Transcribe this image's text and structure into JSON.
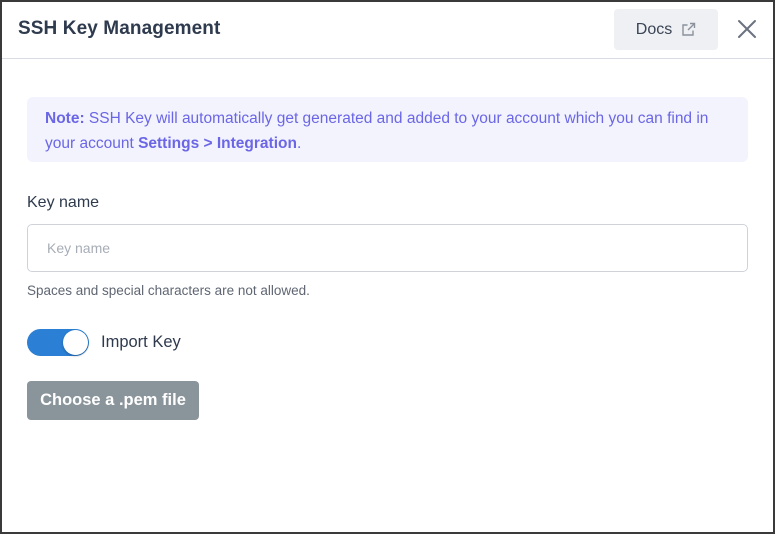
{
  "header": {
    "title": "SSH Key Management",
    "docs_label": "Docs",
    "docs_icon": "external-link-icon",
    "close_icon": "close-icon"
  },
  "note": {
    "prefix": "Note:",
    "text": " SSH Key will automatically get generated and added to your account which you can find in your account ",
    "link_text": "Settings > Integration",
    "suffix": "."
  },
  "form": {
    "key_name_label": "Key name",
    "key_name_value": "",
    "key_name_placeholder": "Key name",
    "key_name_hint": "Spaces and special characters are not allowed.",
    "import_toggle_on": true,
    "import_label": "Import Key",
    "pem_button_label": "Choose a .pem file"
  },
  "colors": {
    "accent": "#2b7fd4",
    "note_text": "#6a66e6",
    "note_bg": "#f3f3fd",
    "pem_button_bg": "#8a959b"
  }
}
